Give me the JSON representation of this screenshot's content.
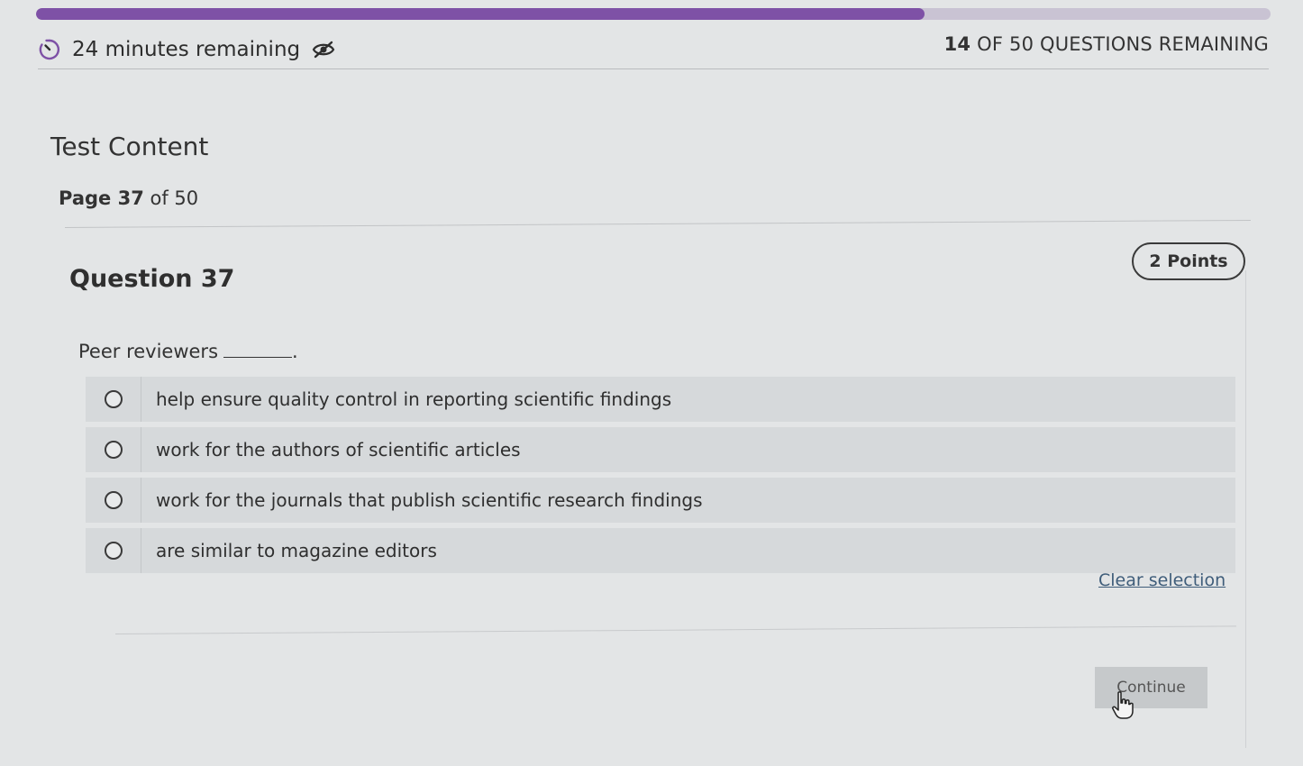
{
  "progress": {
    "fraction": 0.72
  },
  "status": {
    "timer_text": "24 minutes remaining",
    "questions_count": "14",
    "questions_rest": " OF 50 QUESTIONS REMAINING"
  },
  "section": {
    "title": "Test Content"
  },
  "page": {
    "prefix": "Page",
    "current": "37",
    "suffix": "of 50"
  },
  "question": {
    "title": "Question 37",
    "points": "2 Points",
    "prompt": "Peer reviewers",
    "blank_end": ".",
    "options": [
      "help ensure quality control in reporting scientific findings",
      "work for the authors of scientific articles",
      "work for the journals that publish scientific research findings",
      "are similar to magazine editors"
    ]
  },
  "actions": {
    "clear_selection": "Clear selection",
    "continue": "Continue"
  },
  "colors": {
    "progress_fill": "#7e51a6",
    "progress_track": "#c9c3d3",
    "link": "#3f5d7a"
  },
  "icons": {
    "timer": "timer-icon",
    "visibility_off": "eye-off-icon",
    "cursor": "hand-cursor-icon"
  }
}
